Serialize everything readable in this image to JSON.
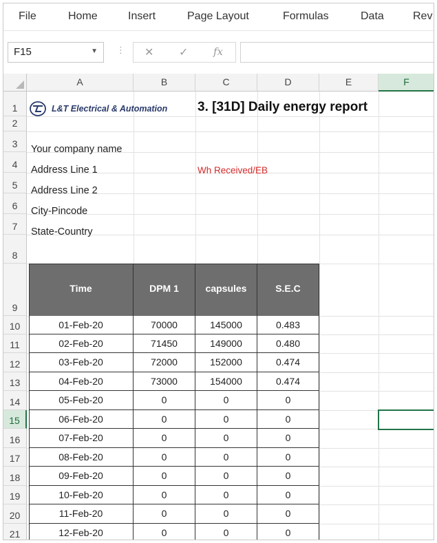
{
  "ribbon": {
    "tabs": [
      "File",
      "Home",
      "Insert",
      "Page Layout",
      "Formulas",
      "Data",
      "Rev"
    ]
  },
  "formula_bar": {
    "name_box": "F15",
    "cancel_icon": "✕",
    "enter_icon": "✓",
    "fx_icon": "fx",
    "formula_value": ""
  },
  "columns": [
    "A",
    "B",
    "C",
    "D",
    "E",
    "F"
  ],
  "selected_column": "F",
  "rows": [
    "1",
    "2",
    "3",
    "4",
    "5",
    "6",
    "7",
    "8",
    "9",
    "10",
    "11",
    "12",
    "13",
    "14",
    "15",
    "16",
    "17",
    "18",
    "19",
    "20",
    "21"
  ],
  "selected_row": "15",
  "header": {
    "logo_text": "L&T Electrical & Automation",
    "title": "3.  [31D] Daily energy report"
  },
  "company": {
    "name": "Your company name",
    "address1": "Address Line 1",
    "address2": "Address Line 2",
    "city": "City-Pincode",
    "state": "State-Country",
    "label_wh": "Wh Received/EB"
  },
  "table": {
    "headers": [
      "Time",
      "DPM 1",
      "capsules",
      "S.E.C"
    ],
    "rows": [
      [
        "01-Feb-20",
        "70000",
        "145000",
        "0.483"
      ],
      [
        "02-Feb-20",
        "71450",
        "149000",
        "0.480"
      ],
      [
        "03-Feb-20",
        "72000",
        "152000",
        "0.474"
      ],
      [
        "04-Feb-20",
        "73000",
        "154000",
        "0.474"
      ],
      [
        "05-Feb-20",
        "0",
        "0",
        "0"
      ],
      [
        "06-Feb-20",
        "0",
        "0",
        "0"
      ],
      [
        "07-Feb-20",
        "0",
        "0",
        "0"
      ],
      [
        "08-Feb-20",
        "0",
        "0",
        "0"
      ],
      [
        "09-Feb-20",
        "0",
        "0",
        "0"
      ],
      [
        "10-Feb-20",
        "0",
        "0",
        "0"
      ],
      [
        "11-Feb-20",
        "0",
        "0",
        "0"
      ],
      [
        "12-Feb-20",
        "0",
        "0",
        "0"
      ]
    ]
  },
  "colors": {
    "accent": "#217346",
    "table_header_bg": "#6e6e6e",
    "red_text": "#d42a2a"
  }
}
